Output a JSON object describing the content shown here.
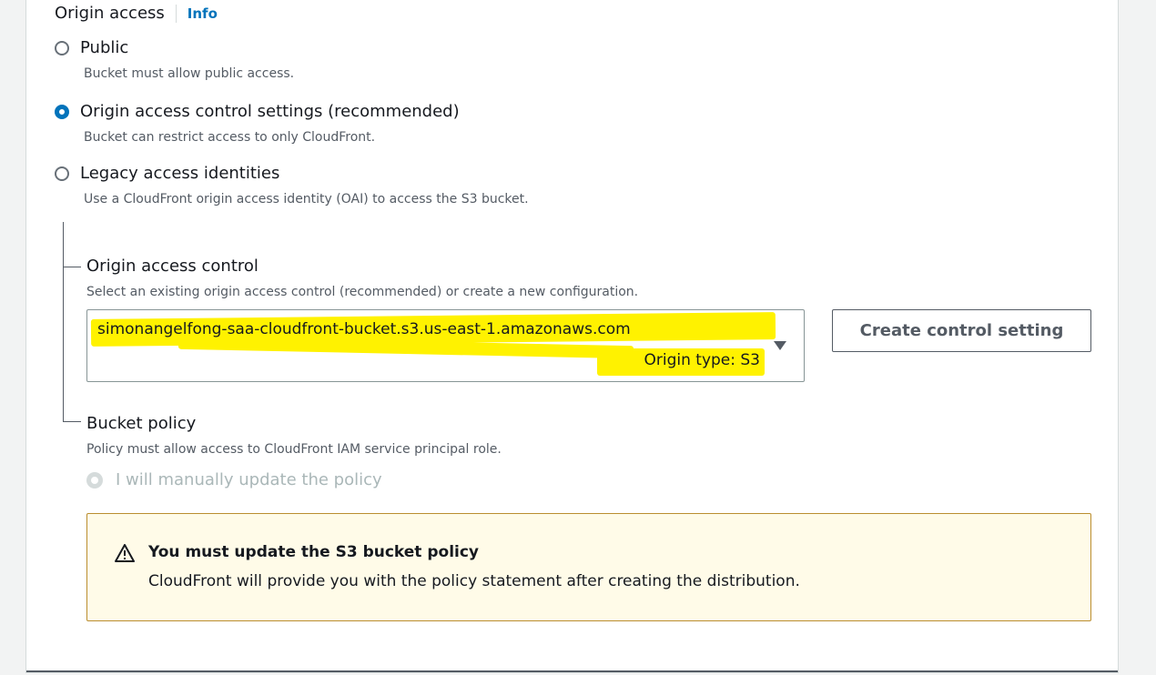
{
  "origin_access": {
    "title": "Origin access",
    "info_link": "Info",
    "options": [
      {
        "label": "Public",
        "description": "Bucket must allow public access.",
        "selected": false
      },
      {
        "label": "Origin access control settings (recommended)",
        "description": "Bucket can restrict access to only CloudFront.",
        "selected": true
      },
      {
        "label": "Legacy access identities",
        "description": "Use a CloudFront origin access identity (OAI) to access the S3 bucket.",
        "selected": false
      }
    ]
  },
  "oac": {
    "label": "Origin access control",
    "description": "Select an existing origin access control (recommended) or create a new configuration.",
    "selected_value": "simonangelfong-saa-cloudfront-bucket.s3.us-east-1.amazonaws.com",
    "selected_subtext": "Origin type: S3",
    "create_button": "Create control setting"
  },
  "bucket_policy": {
    "label": "Bucket policy",
    "description": "Policy must allow access to CloudFront IAM service principal role.",
    "option_label": "I will manually update the policy"
  },
  "alert": {
    "title": "You must update the S3 bucket policy",
    "body": "CloudFront will provide you with the policy statement after creating the distribution."
  },
  "colors": {
    "accent": "#0073bb",
    "highlight": "#fff200",
    "warning_bg": "#fffbe8",
    "warning_border": "#ba8d2f"
  }
}
